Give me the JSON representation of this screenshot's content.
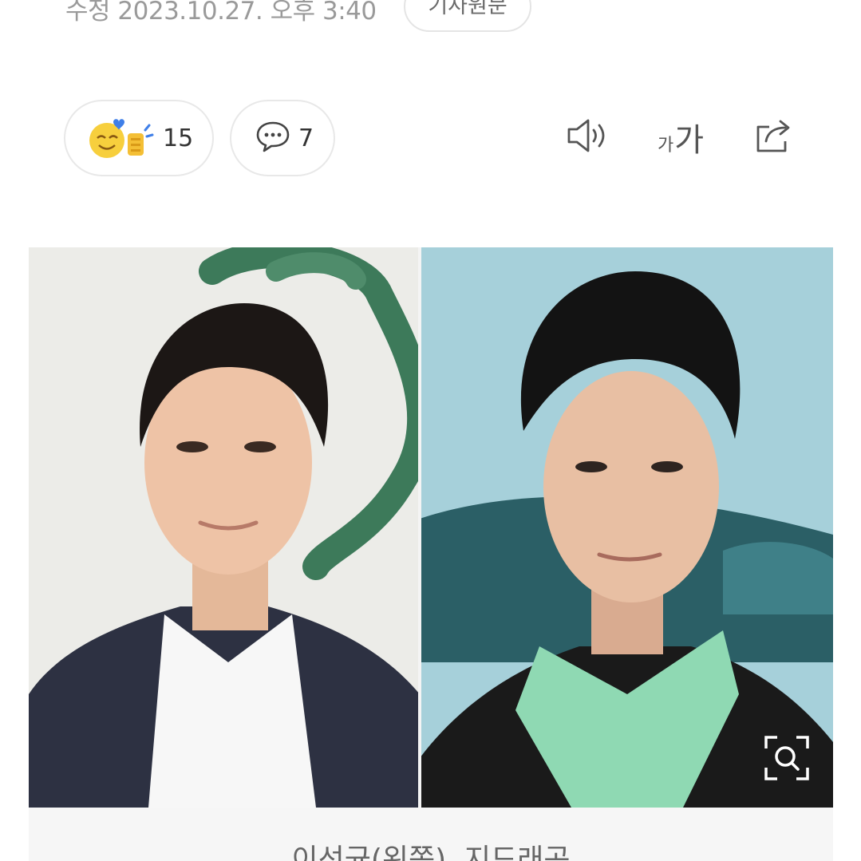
{
  "meta": {
    "date_text": "수정 2023.10.27. 오후 3:40",
    "original_article_label": "기사원문"
  },
  "actions": {
    "reaction_count": "15",
    "comment_count": "7",
    "font_small_label": "가",
    "font_big_label": "가",
    "icons": [
      "reaction-emoji-icon",
      "comment-bubble-icon",
      "speaker-icon",
      "font-size-icon",
      "share-icon",
      "zoom-search-icon"
    ]
  },
  "photo": {
    "caption": "이선균(왼쪽), 지드래곤"
  },
  "colors": {
    "meta_text": "#9a9a9a",
    "pill_border": "#e8e8e8",
    "icon_gray": "#555555",
    "caption_bg": "#f6f6f6"
  }
}
